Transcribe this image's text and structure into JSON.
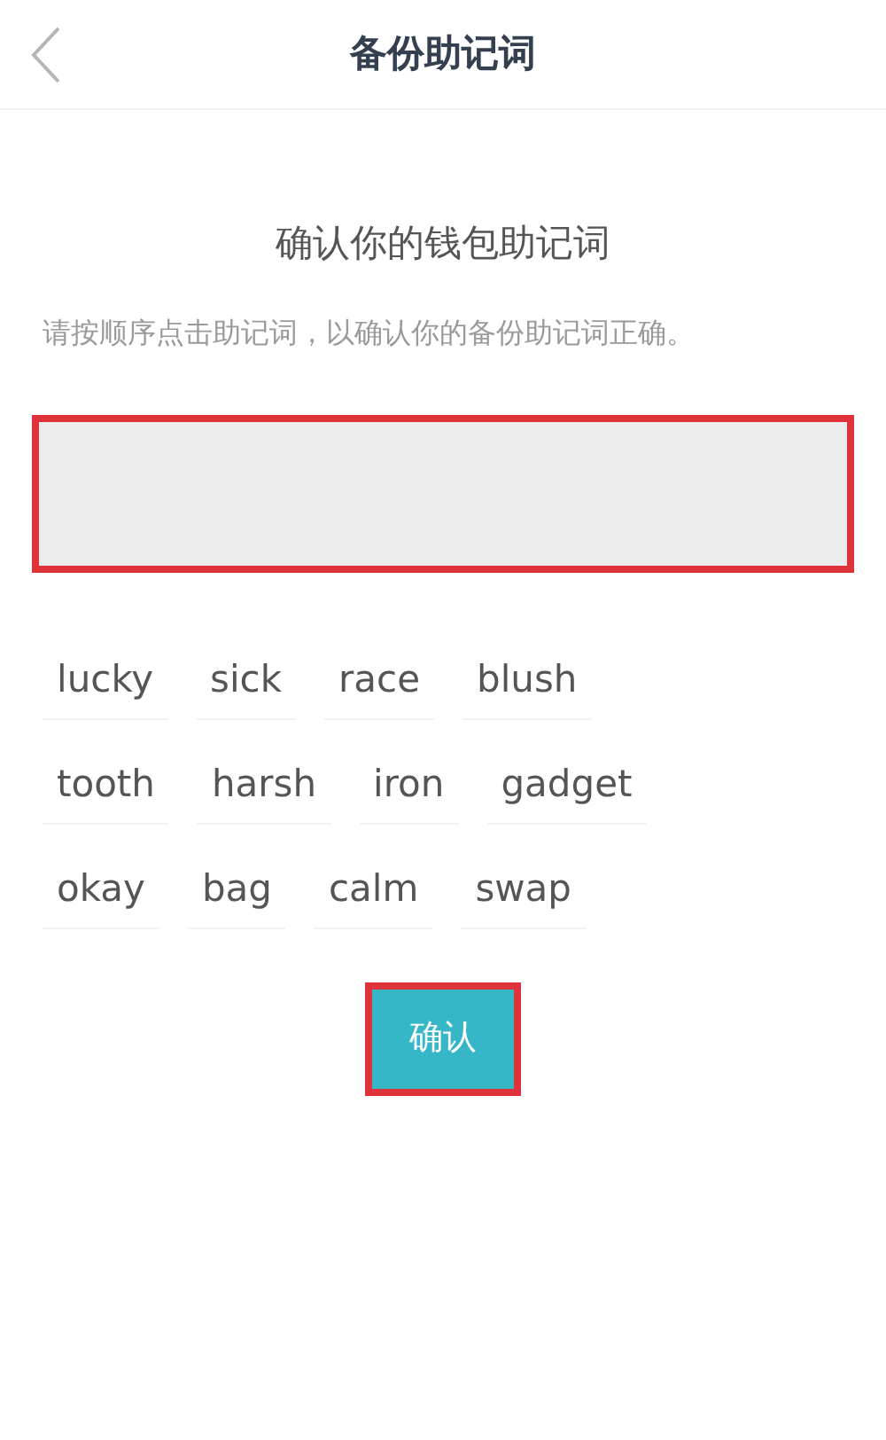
{
  "header": {
    "title": "备份助记词"
  },
  "heading": "确认你的钱包助记词",
  "instructions": "请按顺序点击助记词，以确认你的备份助记词正确。",
  "answer_box": {
    "highlighted": true
  },
  "words": [
    "lucky",
    "sick",
    "race",
    "blush",
    "tooth",
    "harsh",
    "iron",
    "gadget",
    "okay",
    "bag",
    "calm",
    "swap"
  ],
  "confirm_button": {
    "label": "确认",
    "highlighted": true
  }
}
